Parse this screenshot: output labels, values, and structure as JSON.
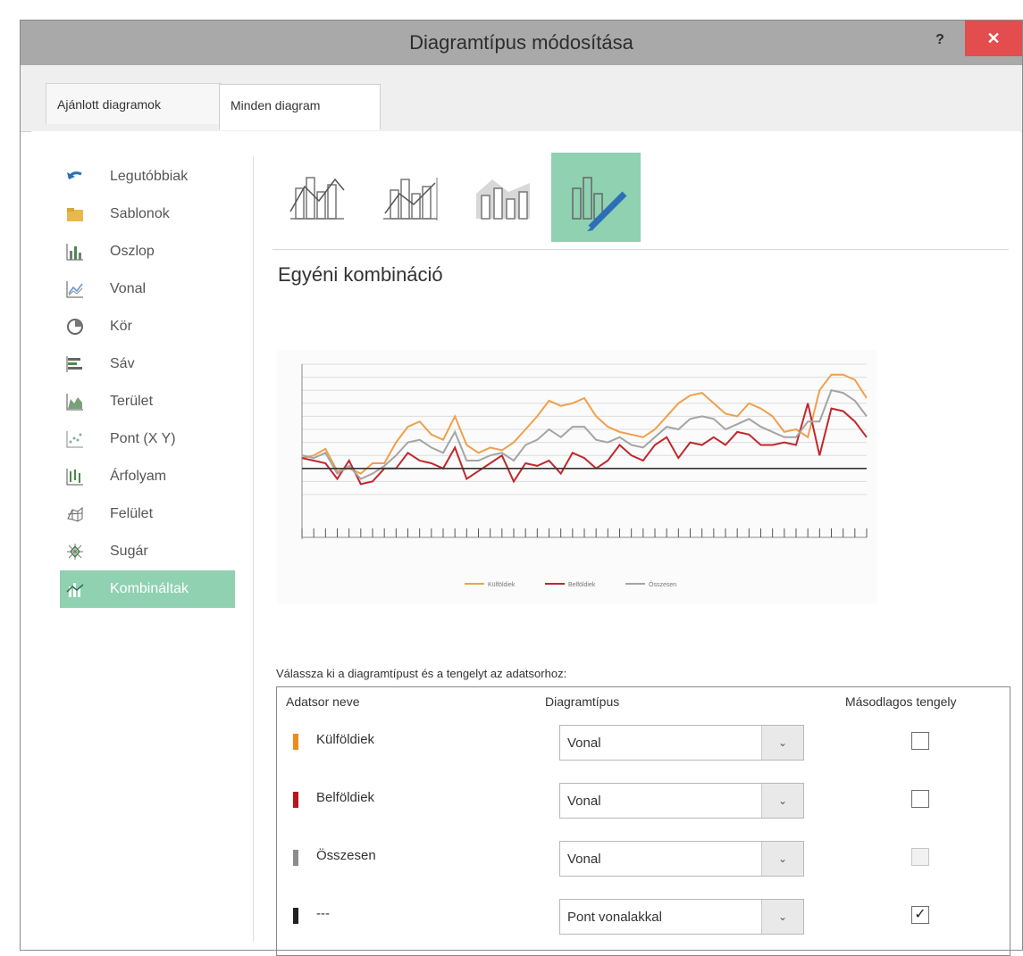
{
  "dialog": {
    "title": "Diagramtípus módosítása",
    "help_label": "?",
    "close_label": "✕"
  },
  "tabs": [
    {
      "label": "Ajánlott diagramok",
      "active": false
    },
    {
      "label": "Minden diagram",
      "active": true
    }
  ],
  "sidebar": {
    "items": [
      {
        "label": "Legutóbbiak",
        "icon": "undo-icon"
      },
      {
        "label": "Sablonok",
        "icon": "folder-icon"
      },
      {
        "label": "Oszlop",
        "icon": "column-chart-icon"
      },
      {
        "label": "Vonal",
        "icon": "line-chart-icon"
      },
      {
        "label": "Kör",
        "icon": "pie-chart-icon"
      },
      {
        "label": "Sáv",
        "icon": "bar-chart-icon"
      },
      {
        "label": "Terület",
        "icon": "area-chart-icon"
      },
      {
        "label": "Pont (X Y)",
        "icon": "scatter-chart-icon"
      },
      {
        "label": "Árfolyam",
        "icon": "stock-chart-icon"
      },
      {
        "label": "Felület",
        "icon": "surface-chart-icon"
      },
      {
        "label": "Sugár",
        "icon": "radar-chart-icon"
      },
      {
        "label": "Kombináltak",
        "icon": "combo-chart-icon",
        "active": true
      }
    ]
  },
  "gallery": {
    "items": [
      {
        "icon": "clustered-column-line-icon",
        "selected": false
      },
      {
        "icon": "clustered-column-line-secondary-icon",
        "selected": false
      },
      {
        "icon": "stacked-area-column-icon",
        "selected": false
      },
      {
        "icon": "custom-combination-icon",
        "selected": true
      }
    ]
  },
  "combo_title": "Egyéni kombináció",
  "chart_data": {
    "type": "line",
    "series": [
      {
        "name": "Külföldiek",
        "color": "#f0a04b",
        "values": [
          108,
          110,
          115,
          98,
          100,
          96,
          104,
          104,
          120,
          132,
          136,
          126,
          122,
          140,
          118,
          112,
          116,
          114,
          120,
          130,
          140,
          152,
          148,
          150,
          154,
          140,
          132,
          128,
          126,
          124,
          130,
          140,
          150,
          156,
          158,
          150,
          142,
          140,
          150,
          146,
          140,
          128,
          130,
          124,
          160,
          172,
          172,
          168,
          154
        ]
      },
      {
        "name": "Belföldiek",
        "color": "#c0282d",
        "values": [
          108,
          106,
          104,
          92,
          106,
          88,
          90,
          100,
          100,
          112,
          106,
          104,
          100,
          116,
          92,
          98,
          104,
          110,
          90,
          104,
          102,
          106,
          96,
          112,
          108,
          100,
          106,
          118,
          110,
          106,
          118,
          124,
          108,
          120,
          118,
          124,
          118,
          128,
          126,
          118,
          118,
          120,
          118,
          150,
          110,
          146,
          144,
          136,
          124
        ]
      },
      {
        "name": "Összesen",
        "color": "#a4a4a4",
        "values": [
          110,
          108,
          112,
          96,
          102,
          92,
          96,
          102,
          110,
          120,
          122,
          116,
          112,
          128,
          106,
          106,
          110,
          112,
          106,
          118,
          122,
          130,
          124,
          132,
          132,
          122,
          120,
          124,
          118,
          116,
          124,
          132,
          130,
          138,
          140,
          138,
          130,
          134,
          138,
          132,
          128,
          124,
          124,
          136,
          136,
          160,
          158,
          152,
          140
        ]
      },
      {
        "name": "---",
        "color": "#333333",
        "values": [
          100,
          100,
          100,
          100,
          100,
          100,
          100,
          100,
          100,
          100,
          100,
          100,
          100,
          100,
          100,
          100,
          100,
          100,
          100,
          100,
          100,
          100,
          100,
          100,
          100,
          100,
          100,
          100,
          100,
          100,
          100,
          100,
          100,
          100,
          100,
          100,
          100,
          100,
          100,
          100,
          100,
          100,
          100,
          100,
          100,
          100,
          100,
          100,
          100
        ]
      }
    ],
    "ylim": [
      80,
      180
    ],
    "grid": true,
    "legend": "bottom",
    "xlabel": "",
    "ylabel": ""
  },
  "series_table": {
    "label": "Válassza ki a diagramtípust és a tengelyt az adatsorhoz:",
    "headers": {
      "name": "Adatsor neve",
      "type": "Diagramtípus",
      "secondary": "Másodlagos tengely"
    },
    "rows": [
      {
        "name": "Külföldiek",
        "color": "#f08a1c",
        "type": "Vonal",
        "secondary": "unchecked"
      },
      {
        "name": "Belföldiek",
        "color": "#c0141c",
        "type": "Vonal",
        "secondary": "unchecked"
      },
      {
        "name": "Összesen",
        "color": "#8c8c8c",
        "type": "Vonal",
        "secondary": "disabled"
      },
      {
        "name": "---",
        "color": "#222222",
        "type": "Pont vonalakkal",
        "secondary": "checked"
      }
    ],
    "dropdown_glyph": "⌄",
    "check_glyph": "✓"
  }
}
